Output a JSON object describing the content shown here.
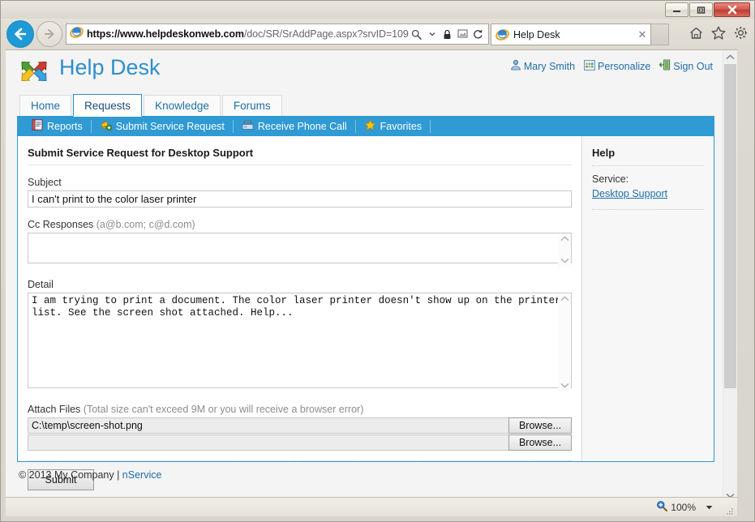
{
  "browser": {
    "window_controls": [
      "minimize",
      "restore",
      "close"
    ],
    "url_bold": "https://www.helpdeskonweb.com",
    "url_rest": "/doc/SR/SrAddPage.aspx?srvID=109",
    "url_full": "https://www.helpdeskonweb.com/doc/SR/SrAddPage.aspx?srvID=109",
    "tab_title": "Help Desk",
    "tab_close_label": "✕",
    "addr_icons": [
      "search-icon",
      "dropdown-caret-icon",
      "lock-icon",
      "compat-view-icon",
      "refresh-icon"
    ],
    "tools": [
      "home-icon",
      "favorites-star-icon",
      "settings-gear-icon"
    ],
    "status": {
      "zoom": "100%"
    }
  },
  "header": {
    "brand_title": "Help Desk",
    "logo": "four-arrow-pinwheel-logo",
    "user_menu": [
      {
        "label": "Mary Smith",
        "icon": "user-icon"
      },
      {
        "label": "Personalize",
        "icon": "grid-icon"
      },
      {
        "label": "Sign Out",
        "icon": "exit-door-icon"
      }
    ]
  },
  "tabs": [
    {
      "label": "Home",
      "active": false
    },
    {
      "label": "Requests",
      "active": true
    },
    {
      "label": "Knowledge",
      "active": false
    },
    {
      "label": "Forums",
      "active": false
    }
  ],
  "toolbar": [
    {
      "label": "Reports",
      "icon": "report-book-icon"
    },
    {
      "label": "Submit Service Request",
      "icon": "megaphone-add-icon"
    },
    {
      "label": "Receive Phone Call",
      "icon": "telephone-icon"
    },
    {
      "label": "Favorites",
      "icon": "star-icon"
    }
  ],
  "form": {
    "title": "Submit Service Request for Desktop Support",
    "subject": {
      "label": "Subject",
      "value": "I can't print to the color laser printer"
    },
    "cc": {
      "label": "Cc Responses",
      "hint": "(a@b.com; c@d.com)",
      "value": ""
    },
    "detail": {
      "label": "Detail",
      "value": "I am trying to print a document. The color laser printer doesn't show up on the printer list. See the screen shot attached. Help..."
    },
    "attach": {
      "label": "Attach Files",
      "hint": "(Total size can't exceed 9M or you will receive a browser error)",
      "rows": [
        {
          "filename": "C:\\temp\\screen-shot.png",
          "button": "Browse..."
        },
        {
          "filename": "",
          "button": "Browse..."
        }
      ]
    },
    "submit_label": "Submit"
  },
  "sidebar": {
    "title": "Help",
    "service_label": "Service:",
    "service_link": "Desktop Support"
  },
  "footer": {
    "copyright": "© 2013 My Company | ",
    "link": "nService"
  },
  "colors": {
    "brand_blue": "#2d8fc9",
    "toolbar_blue": "#2f9ad4",
    "link_blue": "#1f6fa8",
    "close_red": "#bc3c30"
  }
}
